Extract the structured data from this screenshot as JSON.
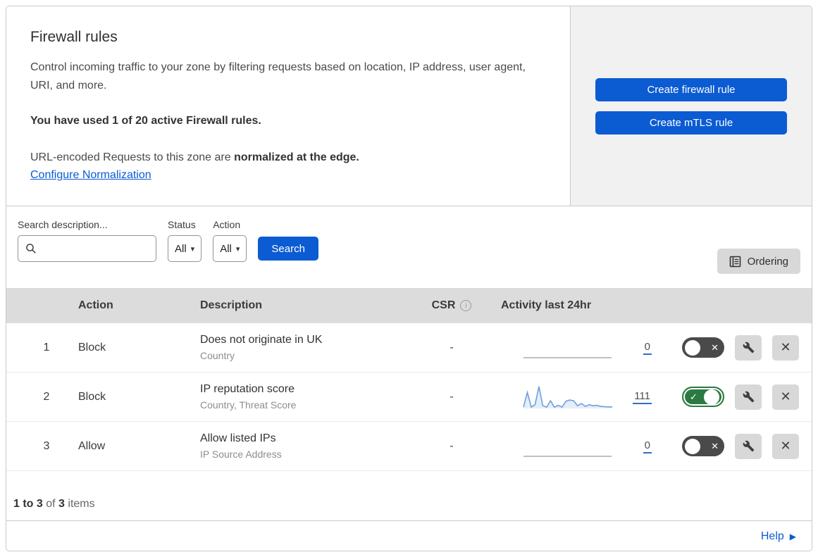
{
  "header": {
    "title": "Firewall rules",
    "description": "Control incoming traffic to your zone by filtering requests based on location, IP address, user agent, URI, and more.",
    "usage": "You have used 1 of 20 active Firewall rules.",
    "normalization_text": "URL-encoded Requests to this zone are ",
    "normalization_bold": "normalized at the edge.",
    "normalization_link": "Configure Normalization",
    "buttons": [
      {
        "label": "Create firewall rule"
      },
      {
        "label": "Create mTLS rule"
      }
    ]
  },
  "filters": {
    "search_label": "Search description...",
    "search_value": "",
    "status_label": "Status",
    "status_value": "All",
    "action_label": "Action",
    "action_value": "All",
    "search_button": "Search",
    "ordering_button": "Ordering"
  },
  "table": {
    "columns": {
      "action": "Action",
      "description": "Description",
      "csr": "CSR",
      "activity": "Activity last 24hr"
    },
    "rows": [
      {
        "index": "1",
        "action": "Block",
        "description": "Does not originate in UK",
        "criteria": "Country",
        "csr": "-",
        "count": "0",
        "enabled": false,
        "sparkline": []
      },
      {
        "index": "2",
        "action": "Block",
        "description": "IP reputation score",
        "criteria": "Country, Threat Score",
        "csr": "-",
        "count": "111",
        "enabled": true,
        "sparkline": [
          3,
          70,
          3,
          14,
          97,
          9,
          3,
          32,
          3,
          11,
          3,
          30,
          35,
          32,
          9,
          19,
          6,
          14,
          9,
          11,
          6,
          5,
          4,
          4
        ]
      },
      {
        "index": "3",
        "action": "Allow",
        "description": "Allow listed IPs",
        "criteria": "IP Source Address",
        "csr": "-",
        "count": "0",
        "enabled": false,
        "sparkline": []
      }
    ]
  },
  "footer": {
    "range": "1 to 3",
    "of_word": "of",
    "total": "3",
    "items_word": "items"
  },
  "help": {
    "label": "Help"
  },
  "icons": {
    "toggle_check": "✓",
    "toggle_x": "✕",
    "close": "✕",
    "caret_down": "▾",
    "help_arrow": "▶",
    "info": "i"
  },
  "colors": {
    "primary_blue": "#0b5bd3",
    "toggle_green": "#2b7a41",
    "toggle_off_gray": "#4a4a4a",
    "sparkline_blue": "#6f9fe0",
    "panel_gray": "#f1f1f1"
  }
}
